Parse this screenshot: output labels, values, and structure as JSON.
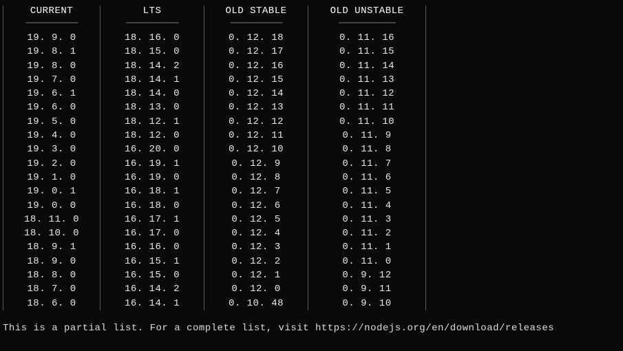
{
  "columns": [
    {
      "header": "CURRENT",
      "divider": "───────────"
    },
    {
      "header": "LTS",
      "divider": "───────────"
    },
    {
      "header": "OLD STABLE",
      "divider": "───────────"
    },
    {
      "header": "OLD UNSTABLE",
      "divider": "────────────"
    }
  ],
  "rows": {
    "current": [
      "19.9.0",
      "19.8.1",
      "19.8.0",
      "19.7.0",
      "19.6.1",
      "19.6.0",
      "19.5.0",
      "19.4.0",
      "19.3.0",
      "19.2.0",
      "19.1.0",
      "19.0.1",
      "19.0.0",
      "18.11.0",
      "18.10.0",
      "18.9.1",
      "18.9.0",
      "18.8.0",
      "18.7.0",
      "18.6.0"
    ],
    "lts": [
      "18.16.0",
      "18.15.0",
      "18.14.2",
      "18.14.1",
      "18.14.0",
      "18.13.0",
      "18.12.1",
      "18.12.0",
      "16.20.0",
      "16.19.1",
      "16.19.0",
      "16.18.1",
      "16.18.0",
      "16.17.1",
      "16.17.0",
      "16.16.0",
      "16.15.1",
      "16.15.0",
      "16.14.2",
      "16.14.1"
    ],
    "oldstable": [
      "0.12.18",
      "0.12.17",
      "0.12.16",
      "0.12.15",
      "0.12.14",
      "0.12.13",
      "0.12.12",
      "0.12.11",
      "0.12.10",
      "0.12.9",
      "0.12.8",
      "0.12.7",
      "0.12.6",
      "0.12.5",
      "0.12.4",
      "0.12.3",
      "0.12.2",
      "0.12.1",
      "0.12.0",
      "0.10.48"
    ],
    "oldunstable": [
      "0.11.16",
      "0.11.15",
      "0.11.14",
      "0.11.13",
      "0.11.12",
      "0.11.11",
      "0.11.10",
      "0.11.9",
      "0.11.8",
      "0.11.7",
      "0.11.6",
      "0.11.5",
      "0.11.4",
      "0.11.3",
      "0.11.2",
      "0.11.1",
      "0.11.0",
      "0.9.12",
      "0.9.11",
      "0.9.10"
    ]
  },
  "footer": "This is a partial list. For a complete list, visit https://nodejs.org/en/download/releases",
  "watermark": ""
}
